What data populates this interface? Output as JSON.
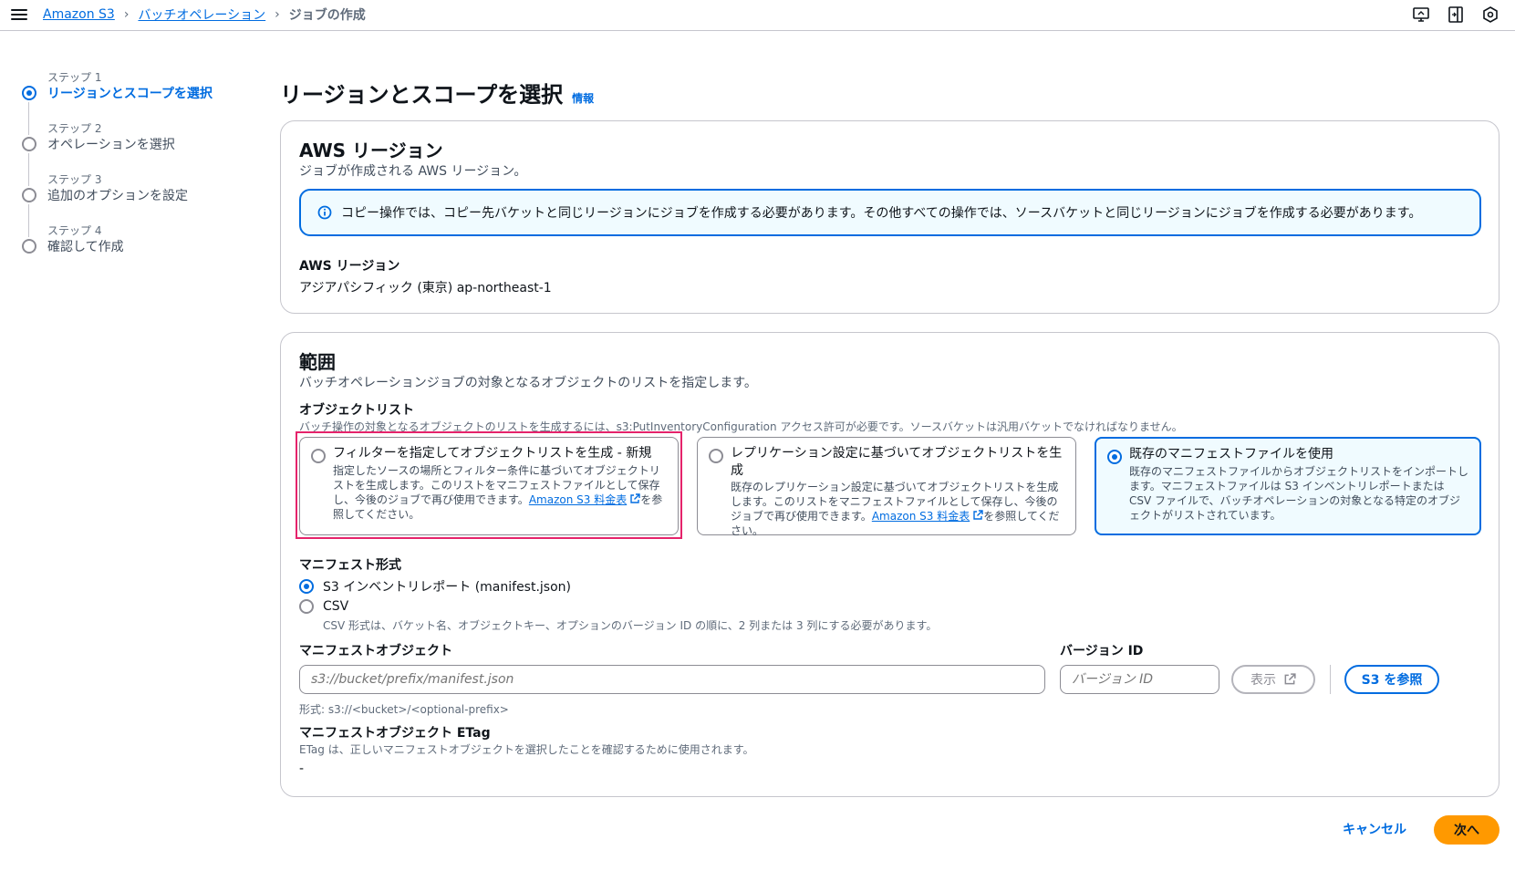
{
  "breadcrumb": {
    "items": [
      "Amazon S3",
      "バッチオペレーション"
    ],
    "current": "ジョブの作成"
  },
  "steps": [
    {
      "num": "ステップ 1",
      "label": "リージョンとスコープを選択"
    },
    {
      "num": "ステップ 2",
      "label": "オペレーションを選択"
    },
    {
      "num": "ステップ 3",
      "label": "追加のオプションを設定"
    },
    {
      "num": "ステップ 4",
      "label": "確認して作成"
    }
  ],
  "page": {
    "title": "リージョンとスコープを選択",
    "info": "情報"
  },
  "region_card": {
    "title": "AWS リージョン",
    "desc": "ジョブが作成される AWS リージョン。",
    "alert": "コピー操作では、コピー先バケットと同じリージョンにジョブを作成する必要があります。その他すべての操作では、ソースバケットと同じリージョンにジョブを作成する必要があります。",
    "field_label": "AWS リージョン",
    "field_value": "アジアパシフィック (東京) ap-northeast-1"
  },
  "scope_card": {
    "title": "範囲",
    "desc": "バッチオペレーションジョブの対象となるオブジェクトのリストを指定します。",
    "object_list_label": "オブジェクトリスト",
    "object_list_hint": "バッチ操作の対象となるオブジェクトのリストを生成するには、s3:PutInventoryConfiguration アクセス許可が必要です。ソースバケットは汎用バケットでなければなりません。",
    "tiles": [
      {
        "title": "フィルターを指定してオブジェクトリストを生成 - 新規",
        "desc_pre": "指定したソースの場所とフィルター条件に基づいてオブジェクトリストを生成します。このリストをマニフェストファイルとして保存し、今後のジョブで再び使用できます。",
        "link": "Amazon S3 料金表",
        "desc_post": "を参照してください。"
      },
      {
        "title": "レプリケーション設定に基づいてオブジェクトリストを生成",
        "desc_pre": "既存のレプリケーション設定に基づいてオブジェクトリストを生成します。このリストをマニフェストファイルとして保存し、今後のジョブで再び使用できます。",
        "link": "Amazon S3 料金表",
        "desc_post": "を参照してください。"
      },
      {
        "title": "既存のマニフェストファイルを使用",
        "desc": "既存のマニフェストファイルからオブジェクトリストをインポートします。マニフェストファイルは S3 インベントリレポートまたは CSV ファイルで、バッチオペレーションの対象となる特定のオブジェクトがリストされています。"
      }
    ],
    "manifest_format_label": "マニフェスト形式",
    "format_options": [
      {
        "label": "S3 インベントリレポート (manifest.json)",
        "selected": true
      },
      {
        "label": "CSV",
        "selected": false
      }
    ],
    "csv_hint": "CSV 形式は、バケット名、オブジェクトキー、オプションのバージョン ID の順に、2 列または 3 列にする必要があります。",
    "manifest_object_label": "マニフェストオブジェクト",
    "manifest_object_placeholder": "s3://bucket/prefix/manifest.json",
    "manifest_object_hint": "形式: s3://<bucket>/<optional-prefix>",
    "version_label": "バージョン ID",
    "version_placeholder": "バージョン ID",
    "view_button": "表示",
    "browse_button": "S3 を参照",
    "etag_label": "マニフェストオブジェクト ETag",
    "etag_hint": "ETag は、正しいマニフェストオブジェクトを選択したことを確認するために使用されます。",
    "etag_value": "-"
  },
  "footer": {
    "cancel": "キャンセル",
    "next": "次へ"
  },
  "colors": {
    "accent": "#006ce0",
    "primary_button": "#ff9900",
    "highlight": "#e5236b"
  }
}
